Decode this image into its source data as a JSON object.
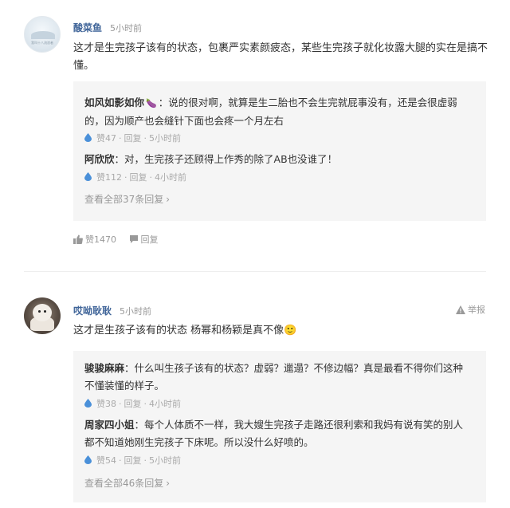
{
  "comments": [
    {
      "author": "酸菜鱼",
      "time": "5小时前",
      "avatar_text": "我叫十八流浪者",
      "text_lines": [
        "这才是生完孩子该有的状态，包裹严实素颜疲态，某些生完孩子就化妆露大腿的实在是搞不",
        "懂。"
      ],
      "replies": [
        {
          "name": "如风如影如你",
          "emoji": "🍆",
          "text_lines": [
            "：说的很对啊，就算是生二胎也不会生完就屁事没有，还是会很虚弱",
            "的，因为顺产也会缝针下面也会疼一个月左右"
          ],
          "likes": "赞47",
          "reply_label": "回复",
          "time": "5小时前"
        },
        {
          "name": "阿欣欣",
          "text_lines": [
            "：对，生完孩子还顾得上作秀的除了AB也没谁了！"
          ],
          "likes": "赞112",
          "reply_label": "回复",
          "time": "4小时前"
        }
      ],
      "view_all": "查看全部37条回复",
      "likes": "赞1470",
      "reply_label": "回复"
    },
    {
      "author": "哎呦耿耿",
      "time": "5小时前",
      "report_label": "举报",
      "text": "这才是生孩子该有的状态 杨幂和杨颖是真不像🙂",
      "replies": [
        {
          "name": "骏骏麻麻",
          "text_lines": [
            "：什么叫生孩子该有的状态？虚弱？邋遢？不修边幅？真是最看不得你们这种",
            "不懂装懂的样子。"
          ],
          "likes": "赞38",
          "reply_label": "回复",
          "time": "4小时前"
        },
        {
          "name": "周家四小姐",
          "text_lines": [
            "：每个人体质不一样，我大嫂生完孩子走路还很利索和我妈有说有笑的别人",
            "都不知道她刚生完孩子下床呢。所以没什么好喷的。"
          ],
          "likes": "赞54",
          "reply_label": "回复",
          "time": "5小时前"
        }
      ],
      "view_all": "查看全部46条回复"
    }
  ],
  "colors": {
    "author": "#406599",
    "meta": "#999999",
    "reply_bg": "#f5f5f5",
    "like_drop": "#4a90d9"
  },
  "icons": {
    "like": "thumbs-up-icon",
    "reply": "chat-bubble-icon",
    "report": "warning-triangle-icon",
    "reply_like": "water-drop-icon"
  }
}
